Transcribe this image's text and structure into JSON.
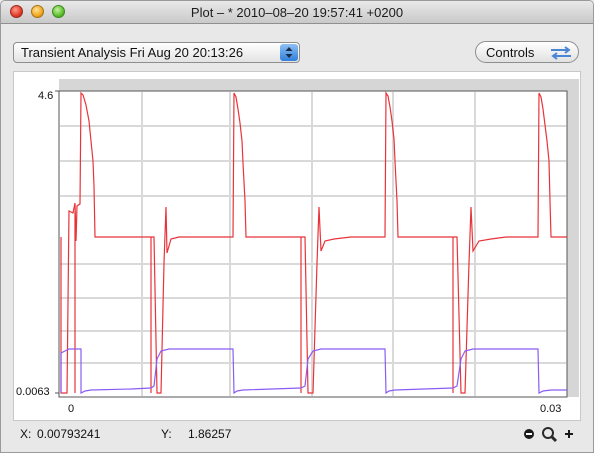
{
  "window": {
    "title": "Plot – * 2010–08–20 19:57:41 +0200"
  },
  "toolbar": {
    "analysis_selector": "Transient Analysis  Fri Aug 20 20:13:26",
    "controls_label": "Controls"
  },
  "plot": {
    "y_top_label": "4.6",
    "y_bottom_label": "0.0063",
    "x_left_label": "0",
    "x_right_label": "0.03",
    "colors": {
      "red_trace": "#e8333a",
      "purple_trace": "#8a5cf5",
      "grid": "#d9d9d9"
    }
  },
  "status": {
    "x_label": "X:",
    "x_value": "0.00793241",
    "y_label": "Y:",
    "y_value": "1.86257"
  },
  "icons": {
    "zoom_out": "zoom-out-icon",
    "zoom": "magnifier-icon",
    "zoom_in": "zoom-in-icon",
    "controls": "swap-arrows-icon"
  }
}
